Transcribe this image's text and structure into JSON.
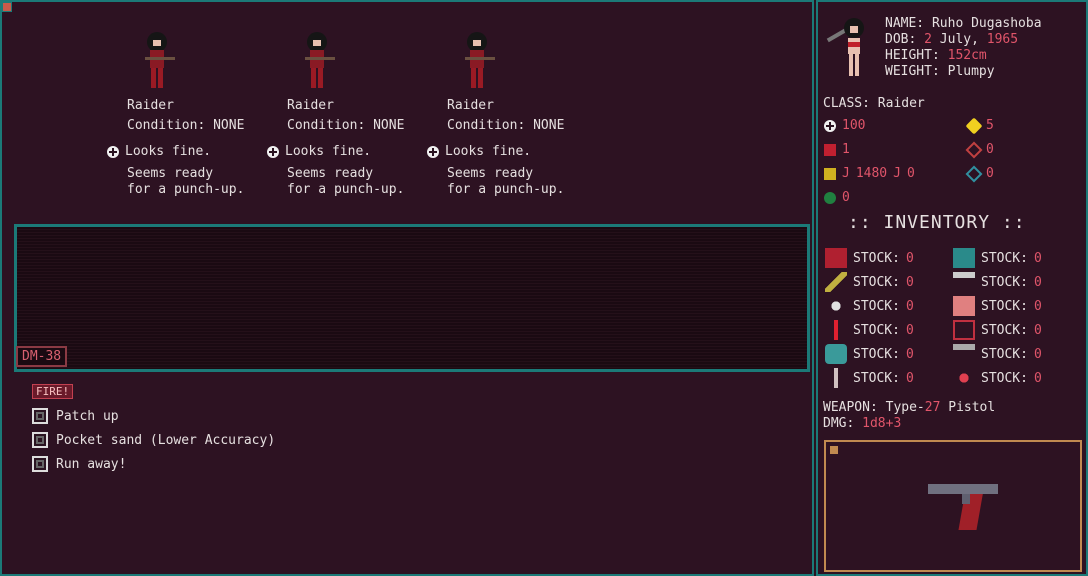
{
  "enemies": [
    {
      "name": "Raider",
      "condition": "Condition: NONE",
      "status": "Looks fine.",
      "desc1": "Seems ready",
      "desc2": "for a punch-up."
    },
    {
      "name": "Raider",
      "condition": "Condition: NONE",
      "status": "Looks fine.",
      "desc1": "Seems ready",
      "desc2": "for a punch-up."
    },
    {
      "name": "Raider",
      "condition": "Condition: NONE",
      "status": "Looks fine.",
      "desc1": "Seems ready",
      "desc2": "for a punch-up."
    }
  ],
  "combat": {
    "dm_label": "DM-38",
    "fire_label": "FIRE!",
    "actions": [
      "Patch up",
      "Pocket sand (Lower Accuracy)",
      "Run away!"
    ]
  },
  "character": {
    "name_label": "NAME:",
    "name": "Ruho Dugashoba",
    "dob_label": "DOB:",
    "dob_day": "2",
    "dob_month": "July,",
    "dob_year": "1965",
    "height_label": "HEIGHT:",
    "height": "152cm",
    "weight_label": "WEIGHT:",
    "weight": "Plumpy",
    "class_label": "CLASS:",
    "class": "Raider"
  },
  "stats": {
    "health": "100",
    "alert": "5",
    "armor": "1",
    "target": "0",
    "money_a": "1480",
    "money_b": "0",
    "shield": "0",
    "special": "0"
  },
  "inventory": {
    "title": ":: INVENTORY ::",
    "stock_label": "STOCK:",
    "items": [
      "0",
      "0",
      "0",
      "0",
      "0",
      "0",
      "0",
      "0",
      "0",
      "0",
      "0",
      "0"
    ]
  },
  "weapon": {
    "label": "WEAPON:",
    "type_prefix": "Type-",
    "type_number": "27",
    "type_suffix": " Pistol",
    "dmg_label": "DMG:",
    "dmg": "1d8+3"
  },
  "colors": {
    "accent": "#1b7a78",
    "highlight": "#e0556a",
    "background": "#2a1320"
  }
}
